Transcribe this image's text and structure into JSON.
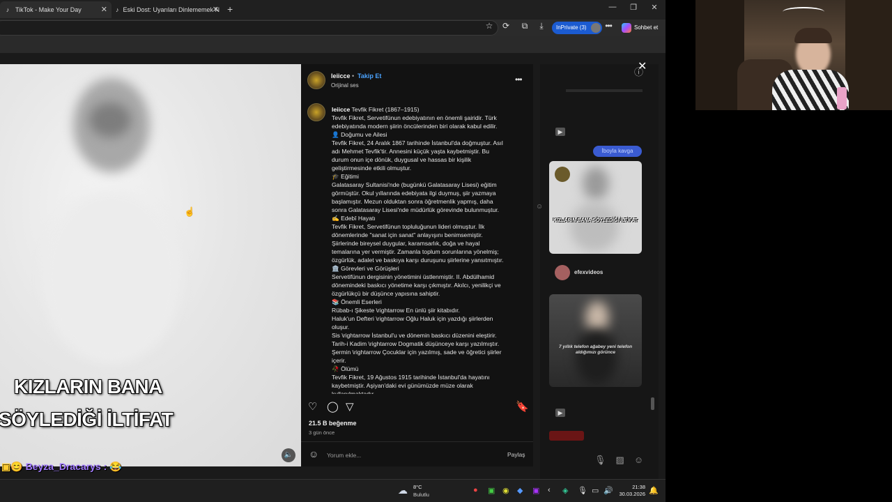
{
  "browser": {
    "tabs": [
      {
        "title": "TikTok - Make Your Day"
      },
      {
        "title": "Eski Dost: Uyarıları Dinlememek N"
      }
    ],
    "new_tab": "+",
    "inprivate_label": "InPrivate (3)",
    "chat_label": "Sohbet et"
  },
  "post": {
    "username": "leiicce",
    "separator": "•",
    "follow_label": "Takip Et",
    "audio_label": "Orijinal ses",
    "more": "•••",
    "caption_user": "leiicce",
    "caption_lines": [
      "Tevfik Fikret (1867–1915)",
      "Tevfik Fikret, Servetifünun edebiyatının en önemli şairidir. Türk",
      "edebiyatında modern şiirin öncülerinden biri olarak kabul edilir.",
      "👤 Doğumu ve Ailesi",
      "Tevfik Fikret, 24 Aralık 1867 tarihinde İstanbul'da doğmuştur. Asıl",
      "adı Mehmet Tevfik'tir. Annesini küçük yaşta kaybetmiştir. Bu",
      "durum onun içe dönük, duygusal ve hassas bir kişilik",
      "geliştirmesinde etkili olmuştur.",
      "🎓 Eğitimi",
      "Galatasaray Sultanisi'nde (bugünkü Galatasaray Lisesi) eğitim",
      "görmüştür. Okul yıllarında edebiyata ilgi duymuş, şiir yazmaya",
      "başlamıştır. Mezun olduktan sonra öğretmenlik yapmış, daha",
      "sonra Galatasaray Lisesi'nde müdürlük görevinde bulunmuştur.",
      "✍️ Edebî Hayatı",
      "Tevfik Fikret, Servetifünun topluluğunun lideri olmuştur. İlk",
      "dönemlerinde \"sanat için sanat\" anlayışını benimsemiştir.",
      "Şiirlerinde bireysel duygular, karamsarlık, doğa ve hayal",
      "temalarına yer vermiştir. Zamanla toplum sorunlarına yönelmiş;",
      "özgürlük, adalet ve baskıya karşı duruşunu şiirlerine yansıtmıştır.",
      "🏛️ Görevleri ve Görüşleri",
      "Servetifünun dergisinin yönetimini üstlenmiştir. II. Abdülhamid",
      "dönemindeki baskıcı yönetime karşı çıkmıştır. Akılcı, yenilikçi ve",
      "özgürlükçü bir düşünce yapısına sahiptir.",
      "📚 Önemli Eserleri",
      "Rübab-ı Şikeste \\rightarrow En ünlü şiir kitabıdır.",
      "Haluk'un Defteri \\rightarrow Oğlu Haluk için yazdığı şiirlerden",
      "oluşur.",
      "Sis \\rightarrow İstanbul'u ve dönemin baskıcı düzenini eleştirir.",
      "Tarih-i Kadim \\rightarrow Dogmatik düşünceye karşı yazılmıştır.",
      "Şermin \\rightarrow Çocuklar için yazılmış, sade ve öğretici şiirler",
      "içerir.",
      "🥀 Ölümü",
      "Tevfik Fikret, 19 Ağustos 1915 tarihinde İstanbul'da hayatını",
      "kaybetmiştir. Aşiyan'daki evi günümüzde müze olarak",
      "kullanılmaktadır."
    ],
    "likes": "21.5 B beğenme",
    "time_ago": "3 gün önce",
    "comment_placeholder": "Yorum ekle...",
    "share_label": "Paylaş"
  },
  "video": {
    "caption_line1": "KIZLARIN BANA",
    "caption_line2": "SÖYLEDİĞİ İLTİFAT"
  },
  "side": {
    "bubble": "İboyla kavga",
    "thumb1_caption": "KIZLARIN BANA SÖYLEDİĞİ İLTİFAT",
    "efex_user": "efexvideos",
    "thumb2_caption": "7 yıllık telefon ağabey yeni telefon aldığımızı görünce"
  },
  "overlay_chat": {
    "name": "Beyza_Dracarys",
    "suffix": " : 😂"
  },
  "taskbar": {
    "temp": "8°C",
    "condition": "Bulutlu",
    "time": "21:38",
    "date": "30.03.2026"
  },
  "icons": [
    "tiktok-icon",
    "close-icon",
    "star-icon",
    "refresh-icon",
    "download-icon",
    "heart-icon",
    "comment-icon",
    "share-icon",
    "bookmark-icon",
    "mute-icon",
    "emoji-icon",
    "cloud-icon",
    "bell-icon"
  ],
  "colors": {
    "accent": "#4aa3ff",
    "inprivate": "#1b5bd1",
    "chat_name": "#a27bff"
  }
}
